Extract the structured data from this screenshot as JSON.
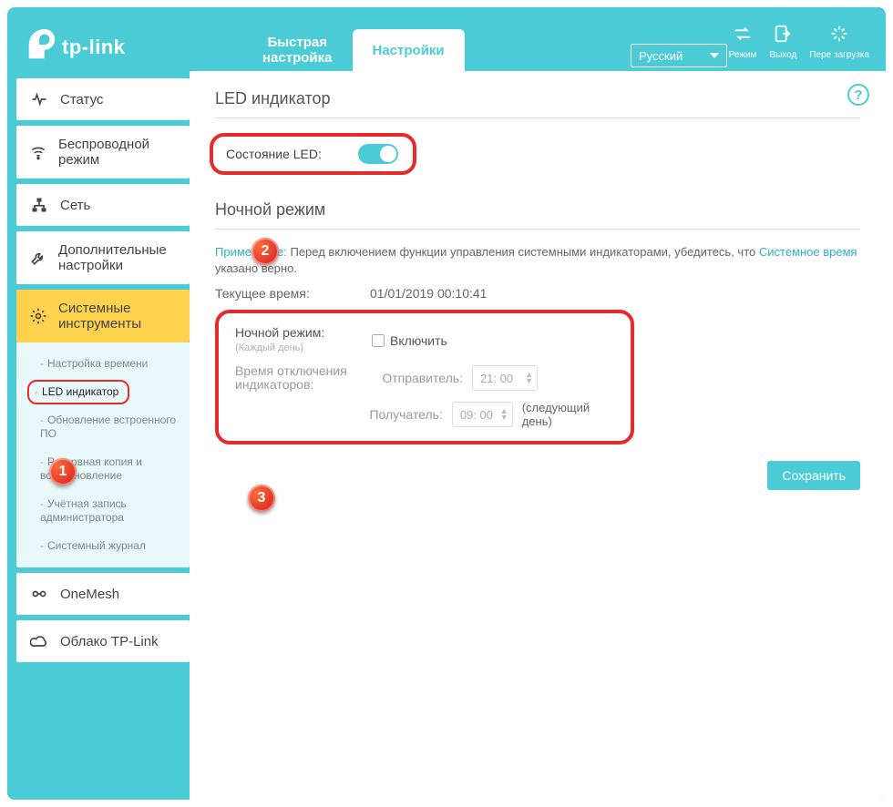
{
  "logo_text": "tp-link",
  "tabs": {
    "quick_line1": "Быстрая",
    "quick_line2": "настройка",
    "settings": "Настройки"
  },
  "language": "Русский",
  "top_actions": {
    "mode": "Режим",
    "exit": "Выход",
    "reload": "Пере загрузка"
  },
  "nav": {
    "status": "Статус",
    "wireless": "Беспроводной режим",
    "network": "Сеть",
    "extra": "Дополнительные настройки",
    "system": "Системные инструменты",
    "onemesh": "OneMesh",
    "cloud": "Облако TP-Link"
  },
  "subnav": {
    "time": "Настройка времени",
    "led": "LED индикатор",
    "firmware": "Обновление встроенного ПО",
    "backup": "Резервная копия и восстановление",
    "admin": "Учётная запись администратора",
    "syslog": "Системный журнал"
  },
  "section1_title": "LED индикатор",
  "led_state_label": "Состояние LED:",
  "section2_title": "Ночной режим",
  "note_prefix": "Примечание:",
  "note_text": "Перед включением функции управления системными индикаторами, убедитесь, что",
  "note_link": "Системное время",
  "note_tail": "указано верно.",
  "current_time_label": "Текущее время:",
  "current_time_value": "01/01/2019 00:10:41",
  "night_mode_label": "Ночной режим:",
  "night_mode_sub": "(Каждый день)",
  "enable_label": "Включить",
  "off_time_label": "Время отключения индикаторов:",
  "sender_label": "Отправитель:",
  "sender_value": "21: 00",
  "receiver_label": "Получатель:",
  "receiver_value": "09: 00",
  "next_day": "(следующий день)",
  "save": "Сохранить",
  "help_glyph": "?"
}
